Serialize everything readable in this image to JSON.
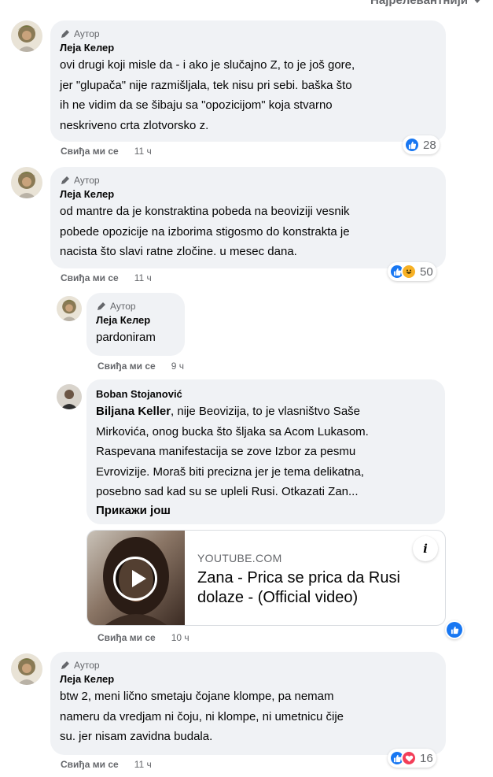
{
  "header": {
    "sort_label": "Најрелевантнији"
  },
  "colors": {
    "like_blue": "#1877f2",
    "love_red": "#f33e58",
    "haha_yellow": "#f7b125",
    "bubble_bg": "#f0f2f5",
    "meta_gray": "#65676b"
  },
  "comments": [
    {
      "badge": "Аутор",
      "name": "Леја Келер",
      "lines": [
        "ovi drugi koji misle da - i ako je slučajno Z, to je još gore,",
        "jer \"glupača\" nije razmišljala, tek nisu pri sebi. baška što",
        "ih ne vidim da se šibaju sa \"opozicijom\" koja stvarno",
        "neskriveno crta zlotvorsko z."
      ],
      "like_label": "Свиђа ми се",
      "time": "11 ч",
      "reaction_icons": [
        "like-icon"
      ],
      "reaction_count": "28"
    },
    {
      "badge": "Аутор",
      "name": "Леја Келер",
      "lines": [
        "od mantre da je konstraktina pobeda na beoviziji vesnik",
        "pobede opozicije na izborima stigosmo do konstrakta je",
        "nacista što slavi ratne zločine. u mesec dana."
      ],
      "like_label": "Свиђа ми се",
      "time": "11 ч",
      "reaction_icons": [
        "like-icon",
        "haha-icon"
      ],
      "reaction_count": "50"
    },
    {
      "badge": "Аутор",
      "name": "Леја Келер",
      "lines": [
        "pardoniram"
      ],
      "like_label": "Свиђа ми се",
      "time": "9 ч"
    },
    {
      "name": "Boban Stojanović",
      "mention": "Biljana Keller",
      "first_line_rest": ", nije Beovizija, to je vlasništvo Saše",
      "lines": [
        "Mirkovića, onog bucka što šljaka sa Acom Lukasom.",
        "Raspevana manifestacija se zove Izbor za pesmu",
        "Evrovizije. Moraš biti precizna jer je tema delikatna,",
        "posebno sad kad su se upleli Rusi. Otkazati Zan..."
      ],
      "see_more": "Прикажи још",
      "link": {
        "domain": "YOUTUBE.COM",
        "title_lines": [
          "Zana - Prica se prica da Rusi",
          "dolaze - (Official video)"
        ],
        "info_icon": "info-icon"
      },
      "like_label": "Свиђа ми се",
      "time": "10 ч",
      "reaction_icons": [
        "like-icon"
      ]
    },
    {
      "badge": "Аутор",
      "name": "Леја Келер",
      "lines": [
        "btw 2, meni lično smetaju čojane klompe, pa nemam",
        "nameru da vredjam ni čoju, ni klompe, ni umetnicu čije",
        "su. jer nisam zavidna budala."
      ],
      "like_label": "Свиђа ми се",
      "time": "11 ч",
      "reaction_icons": [
        "like-icon",
        "love-icon"
      ],
      "reaction_count": "16"
    }
  ]
}
